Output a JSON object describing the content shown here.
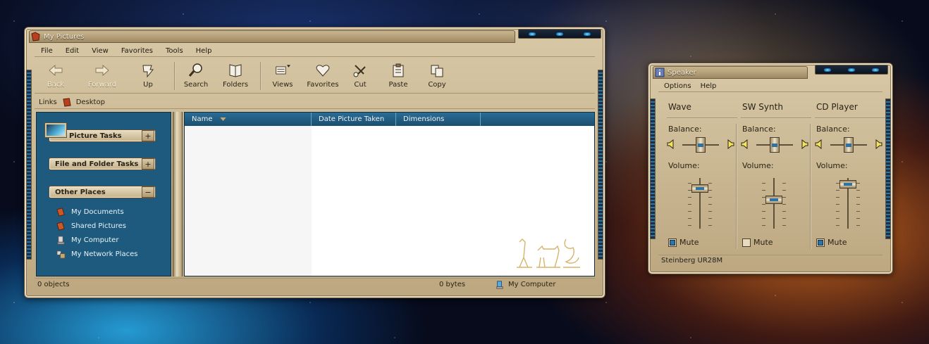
{
  "explorer": {
    "title": "My Pictures",
    "menu": [
      "File",
      "Edit",
      "View",
      "Favorites",
      "Tools",
      "Help"
    ],
    "toolbar": {
      "back": "Back",
      "forward": "Forward",
      "up": "Up",
      "search": "Search",
      "folders": "Folders",
      "views": "Views",
      "favorites": "Favorites",
      "cut": "Cut",
      "paste": "Paste",
      "copy": "Copy"
    },
    "links": {
      "label": "Links",
      "desktop": "Desktop"
    },
    "tasks": {
      "picture_tasks": "Picture Tasks",
      "file_folder_tasks": "File and Folder Tasks",
      "other_places": "Other Places",
      "places": [
        "My Documents",
        "Shared Pictures",
        "My Computer",
        "My Network Places"
      ]
    },
    "columns": [
      "Name",
      "Date Picture Taken",
      "Dimensions"
    ],
    "status": {
      "objects": "0 objects",
      "size": "0 bytes",
      "location": "My Computer"
    }
  },
  "mixer": {
    "title": "Speaker",
    "menu": [
      "Options",
      "Help"
    ],
    "channels": [
      {
        "name": "Wave",
        "balance_label": "Balance:",
        "volume_label": "Volume:",
        "mute_label": "Mute",
        "balance": 0.5,
        "volume": 0.85,
        "muted": true
      },
      {
        "name": "SW Synth",
        "balance_label": "Balance:",
        "volume_label": "Volume:",
        "mute_label": "Mute",
        "balance": 0.5,
        "volume": 0.58,
        "muted": false
      },
      {
        "name": "CD Player",
        "balance_label": "Balance:",
        "volume_label": "Volume:",
        "mute_label": "Mute",
        "balance": 0.5,
        "volume": 0.95,
        "muted": true
      }
    ],
    "status": "Steinberg UR28M"
  },
  "colors": {
    "chrome": "#c9b68f",
    "panel": "#1e5a7d",
    "accent": "#2d74a4"
  }
}
